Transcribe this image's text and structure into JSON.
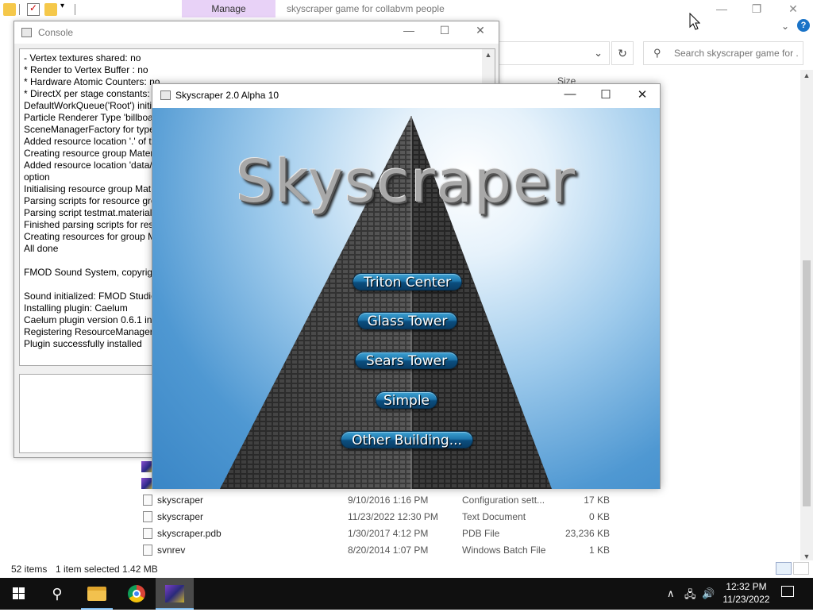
{
  "explorer": {
    "ribbon_tab": "Manage",
    "title": "skyscraper game for collabvm people",
    "search_placeholder": "Search skyscraper game for ...",
    "column_size": "Size",
    "files": [
      {
        "name": "skyscraper",
        "date": "9/10/2016 1:16 PM",
        "type": "Configuration sett...",
        "size": "17 KB"
      },
      {
        "name": "skyscraper",
        "date": "11/23/2022 12:30 PM",
        "type": "Text Document",
        "size": "0 KB"
      },
      {
        "name": "skyscraper.pdb",
        "date": "1/30/2017 4:12 PM",
        "type": "PDB File",
        "size": "23,236 KB"
      },
      {
        "name": "svnrev",
        "date": "8/20/2014 1:07 PM",
        "type": "Windows Batch File",
        "size": "1 KB"
      }
    ],
    "status_items": "52 items",
    "status_selected": "1 item selected  1.42 MB",
    "controls": {
      "minimize": "—",
      "maximize": "❐",
      "close": "✕"
    }
  },
  "console": {
    "title": "Console",
    "lines": [
      "   - Vertex textures shared: no",
      " * Render to Vertex Buffer : no",
      " * Hardware Atomic Counters: no",
      " * DirectX per stage constants: y",
      "DefaultWorkQueue('Root') initi",
      "Particle Renderer Type 'billboar",
      "SceneManagerFactory for type",
      "Added resource location '.' of t",
      "Creating resource group Mater",
      "Added resource location 'data/",
      "option",
      "Initialising resource group Mat",
      "Parsing scripts for resource gro",
      "Parsing script testmat.material",
      "Finished parsing scripts for reso",
      "Creating resources for group M",
      "All done",
      "",
      " FMOD Sound System, copyrig",
      "",
      "Sound initialized: FMOD Studio",
      "Installing plugin: Caelum",
      "Caelum plugin version 0.6.1 ins",
      "Registering ResourceManager f",
      "Plugin successfully installed"
    ],
    "controls": {
      "minimize": "—",
      "maximize": "☐",
      "close": "✕"
    }
  },
  "skyscraper": {
    "title": "Skyscraper 2.0 Alpha 10",
    "logo": "Skyscraper",
    "buttons": [
      "Triton Center",
      "Glass Tower",
      "Sears Tower",
      "Simple",
      "Other Building..."
    ],
    "controls": {
      "minimize": "—",
      "maximize": "☐",
      "close": "✕"
    }
  },
  "taskbar": {
    "time": "12:32 PM",
    "date": "11/23/2022",
    "tray_chevron": "∧",
    "tray_network": "🖧",
    "tray_volume": "🔊"
  },
  "colors": {
    "button_blue": "#1e77ad",
    "sky_blue": "#4f98d2",
    "manage_tab": "#e8d2f7",
    "taskbar": "#101010"
  }
}
